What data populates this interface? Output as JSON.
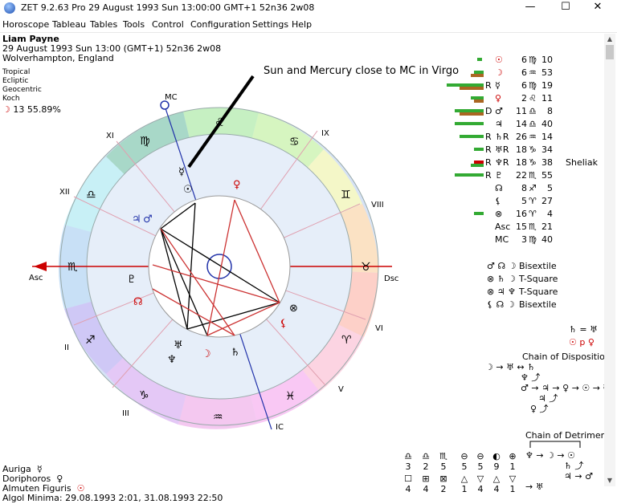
{
  "window": {
    "title": "ZET 9.2.63 Pro   29 August 1993  Sun  13:00:00 GMT+1 52n36  2w08",
    "minimize": "—",
    "maximize": "☐",
    "close": "✕"
  },
  "menu": [
    "Horoscope",
    "Tableau",
    "Tables",
    "Tools",
    "Control",
    "Configuration",
    "Settings",
    "Help"
  ],
  "person": {
    "name": "Liam Payne",
    "datetime": "29 August 1993  Sun  13:00 (GMT+1) 52n36  2w08",
    "place": "Wolverhampton, England"
  },
  "settings_lines": [
    "Tropical",
    "Ecliptic",
    "Geocentric",
    "Koch"
  ],
  "moon_phase": {
    "glyph": "☽",
    "value": "13 55.89%"
  },
  "annotation": "Sun and Mercury close to MC in Virgo",
  "wheel": {
    "houses": [
      "IX",
      "VIII",
      "VI",
      "V",
      "III",
      "II",
      "XII",
      "XI"
    ],
    "angles": {
      "mc": "MC",
      "ic": "IC",
      "asc": "Asc",
      "dsc": "Dsc"
    },
    "signs": [
      "♌",
      "♋",
      "♊",
      "♉",
      "♈",
      "♓",
      "♒",
      "♑",
      "♐",
      "♏",
      "♎",
      "♍"
    ]
  },
  "positions": [
    {
      "retro": "",
      "glyph": "☉",
      "deg": "6",
      "sign": "♍",
      "min": "10",
      "color": "#c00"
    },
    {
      "retro": "",
      "glyph": "☽",
      "deg": "6",
      "sign": "♒",
      "min": "53",
      "color": "#c00"
    },
    {
      "retro": "R",
      "glyph": "☿",
      "deg": "6",
      "sign": "♍",
      "min": "19",
      "color": "#000"
    },
    {
      "retro": "",
      "glyph": "♀",
      "deg": "2",
      "sign": "♌",
      "min": "11",
      "color": "#c00"
    },
    {
      "retro": "D",
      "glyph": "♂",
      "deg": "11",
      "sign": "♎",
      "min": "8",
      "color": "#000"
    },
    {
      "retro": "",
      "glyph": "♃",
      "deg": "14",
      "sign": "♎",
      "min": "40",
      "color": "#000"
    },
    {
      "retro": "R",
      "glyph": "♄R",
      "deg": "26",
      "sign": "♒",
      "min": "14",
      "color": "#000"
    },
    {
      "retro": "R",
      "glyph": "♅R",
      "deg": "18",
      "sign": "♑",
      "min": "34",
      "color": "#000"
    },
    {
      "retro": "R",
      "glyph": "♆R",
      "deg": "18",
      "sign": "♑",
      "min": "38",
      "color": "#000"
    },
    {
      "retro": "R",
      "glyph": "♇",
      "deg": "22",
      "sign": "♏",
      "min": "55",
      "color": "#000"
    },
    {
      "retro": "",
      "glyph": "☊",
      "deg": "8",
      "sign": "♐",
      "min": "5",
      "color": "#000"
    },
    {
      "retro": "",
      "glyph": "⚸",
      "deg": "5",
      "sign": "♈",
      "min": "27",
      "color": "#000"
    },
    {
      "retro": "",
      "glyph": "⊗",
      "deg": "16",
      "sign": "♈",
      "min": "4",
      "color": "#000"
    },
    {
      "retro": "",
      "glyph": "Asc",
      "deg": "15",
      "sign": "♏",
      "min": "21",
      "color": "#000"
    },
    {
      "retro": "",
      "glyph": "MC",
      "deg": "3",
      "sign": "♍",
      "min": "40",
      "color": "#000"
    }
  ],
  "sheliak": "Sheliak",
  "aspect_patterns": [
    {
      "glyphs": "♂ ☊ ☽",
      "label": "Bisextile"
    },
    {
      "glyphs": "⊗ ♄ ☽",
      "label": "T-Square"
    },
    {
      "glyphs": "⊗ ♃ ♆",
      "label": "T-Square"
    },
    {
      "glyphs": "⚸ ☊ ☽",
      "label": "Bisextile"
    }
  ],
  "reception": [
    "♄ = ♅",
    "☉ p ♀"
  ],
  "chain_disposition": {
    "title": "Chain of Disposition",
    "lines": [
      "☽ → ♅ ↔ ♄",
      "♆ ⤴",
      "♂ → ♃ → ♀ → ☉ → ☿",
      "♃ ⤴",
      "♀ ⤴"
    ]
  },
  "chain_detriment": {
    "title": "Chain of Detriment",
    "lines": [
      "♆ → ☽ → ☉",
      "♄ ⤴",
      "♃ → ♂",
      "→ ♅"
    ]
  },
  "elements_table": {
    "icons1": [
      "♎",
      "♎",
      "♏"
    ],
    "vals1": [
      "3",
      "2",
      "5"
    ],
    "icons2": [
      "☐",
      "⊞",
      "⊠"
    ],
    "vals2": [
      "4",
      "4",
      "2"
    ],
    "icons3": [
      "⊖",
      "⊖",
      "◐",
      "⊕"
    ],
    "vals3": [
      "5",
      "5",
      "9",
      "1"
    ],
    "icons4": [
      "△",
      "▽",
      "△",
      "▽"
    ],
    "vals4": [
      "1",
      "4",
      "4",
      "1"
    ]
  },
  "bottom": {
    "lines": [
      {
        "label": "Auriga",
        "glyph": "☿"
      },
      {
        "label": "Doriphoros",
        "glyph": "♀"
      },
      {
        "label": "Almuten Figuris",
        "glyph": "☉"
      }
    ],
    "algol": "Algol Minima: 29.08.1993  2:01,  31.08.1993 22:50"
  }
}
